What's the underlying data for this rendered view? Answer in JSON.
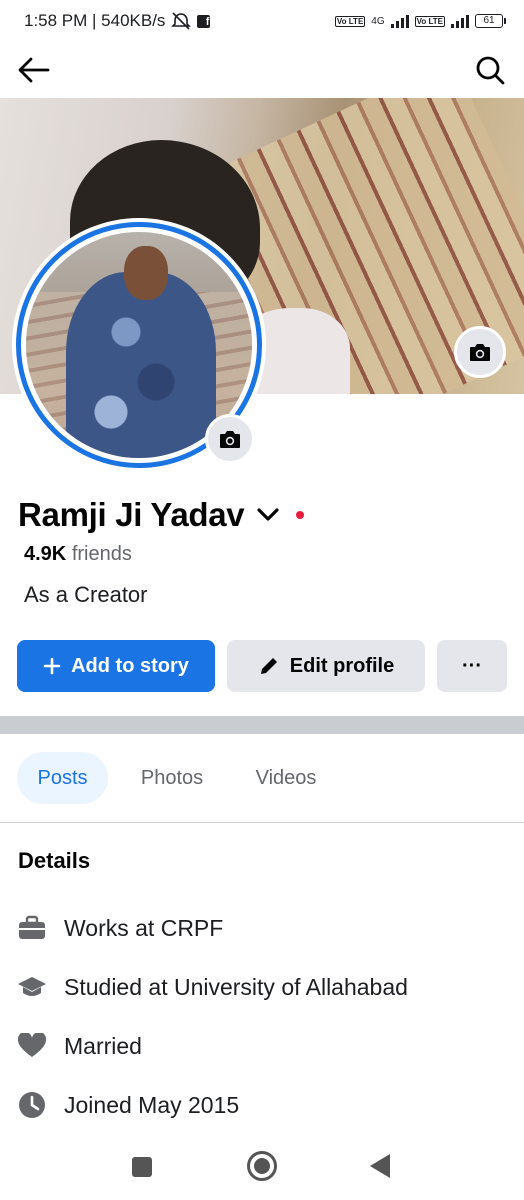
{
  "status_bar": {
    "time_speed": "1:58 PM | 540KB/s",
    "network_label": "4G",
    "volte_label": "Vo LTE",
    "battery": "61"
  },
  "header": {
    "back_icon": "arrow-left-icon",
    "search_icon": "search-icon"
  },
  "profile": {
    "name": "Ramji Ji Yadav",
    "friends_count": "4.9K",
    "friends_label": "friends",
    "bio": "As a Creator"
  },
  "actions": {
    "add_story": "Add to story",
    "edit_profile": "Edit profile",
    "more": "···"
  },
  "tabs": [
    "Posts",
    "Photos",
    "Videos"
  ],
  "details": {
    "title": "Details",
    "items": [
      {
        "icon": "briefcase-icon",
        "text": "Works at CRPF"
      },
      {
        "icon": "graduation-cap-icon",
        "text": "Studied at University of Allahabad"
      },
      {
        "icon": "heart-icon",
        "text": "Married"
      },
      {
        "icon": "clock-icon",
        "text": "Joined May 2015"
      }
    ]
  },
  "colors": {
    "accent": "#1b74e4",
    "secondary_button": "#e4e6eb",
    "active_tab_bg": "#ebf5ff",
    "muted_text": "#65676b"
  }
}
